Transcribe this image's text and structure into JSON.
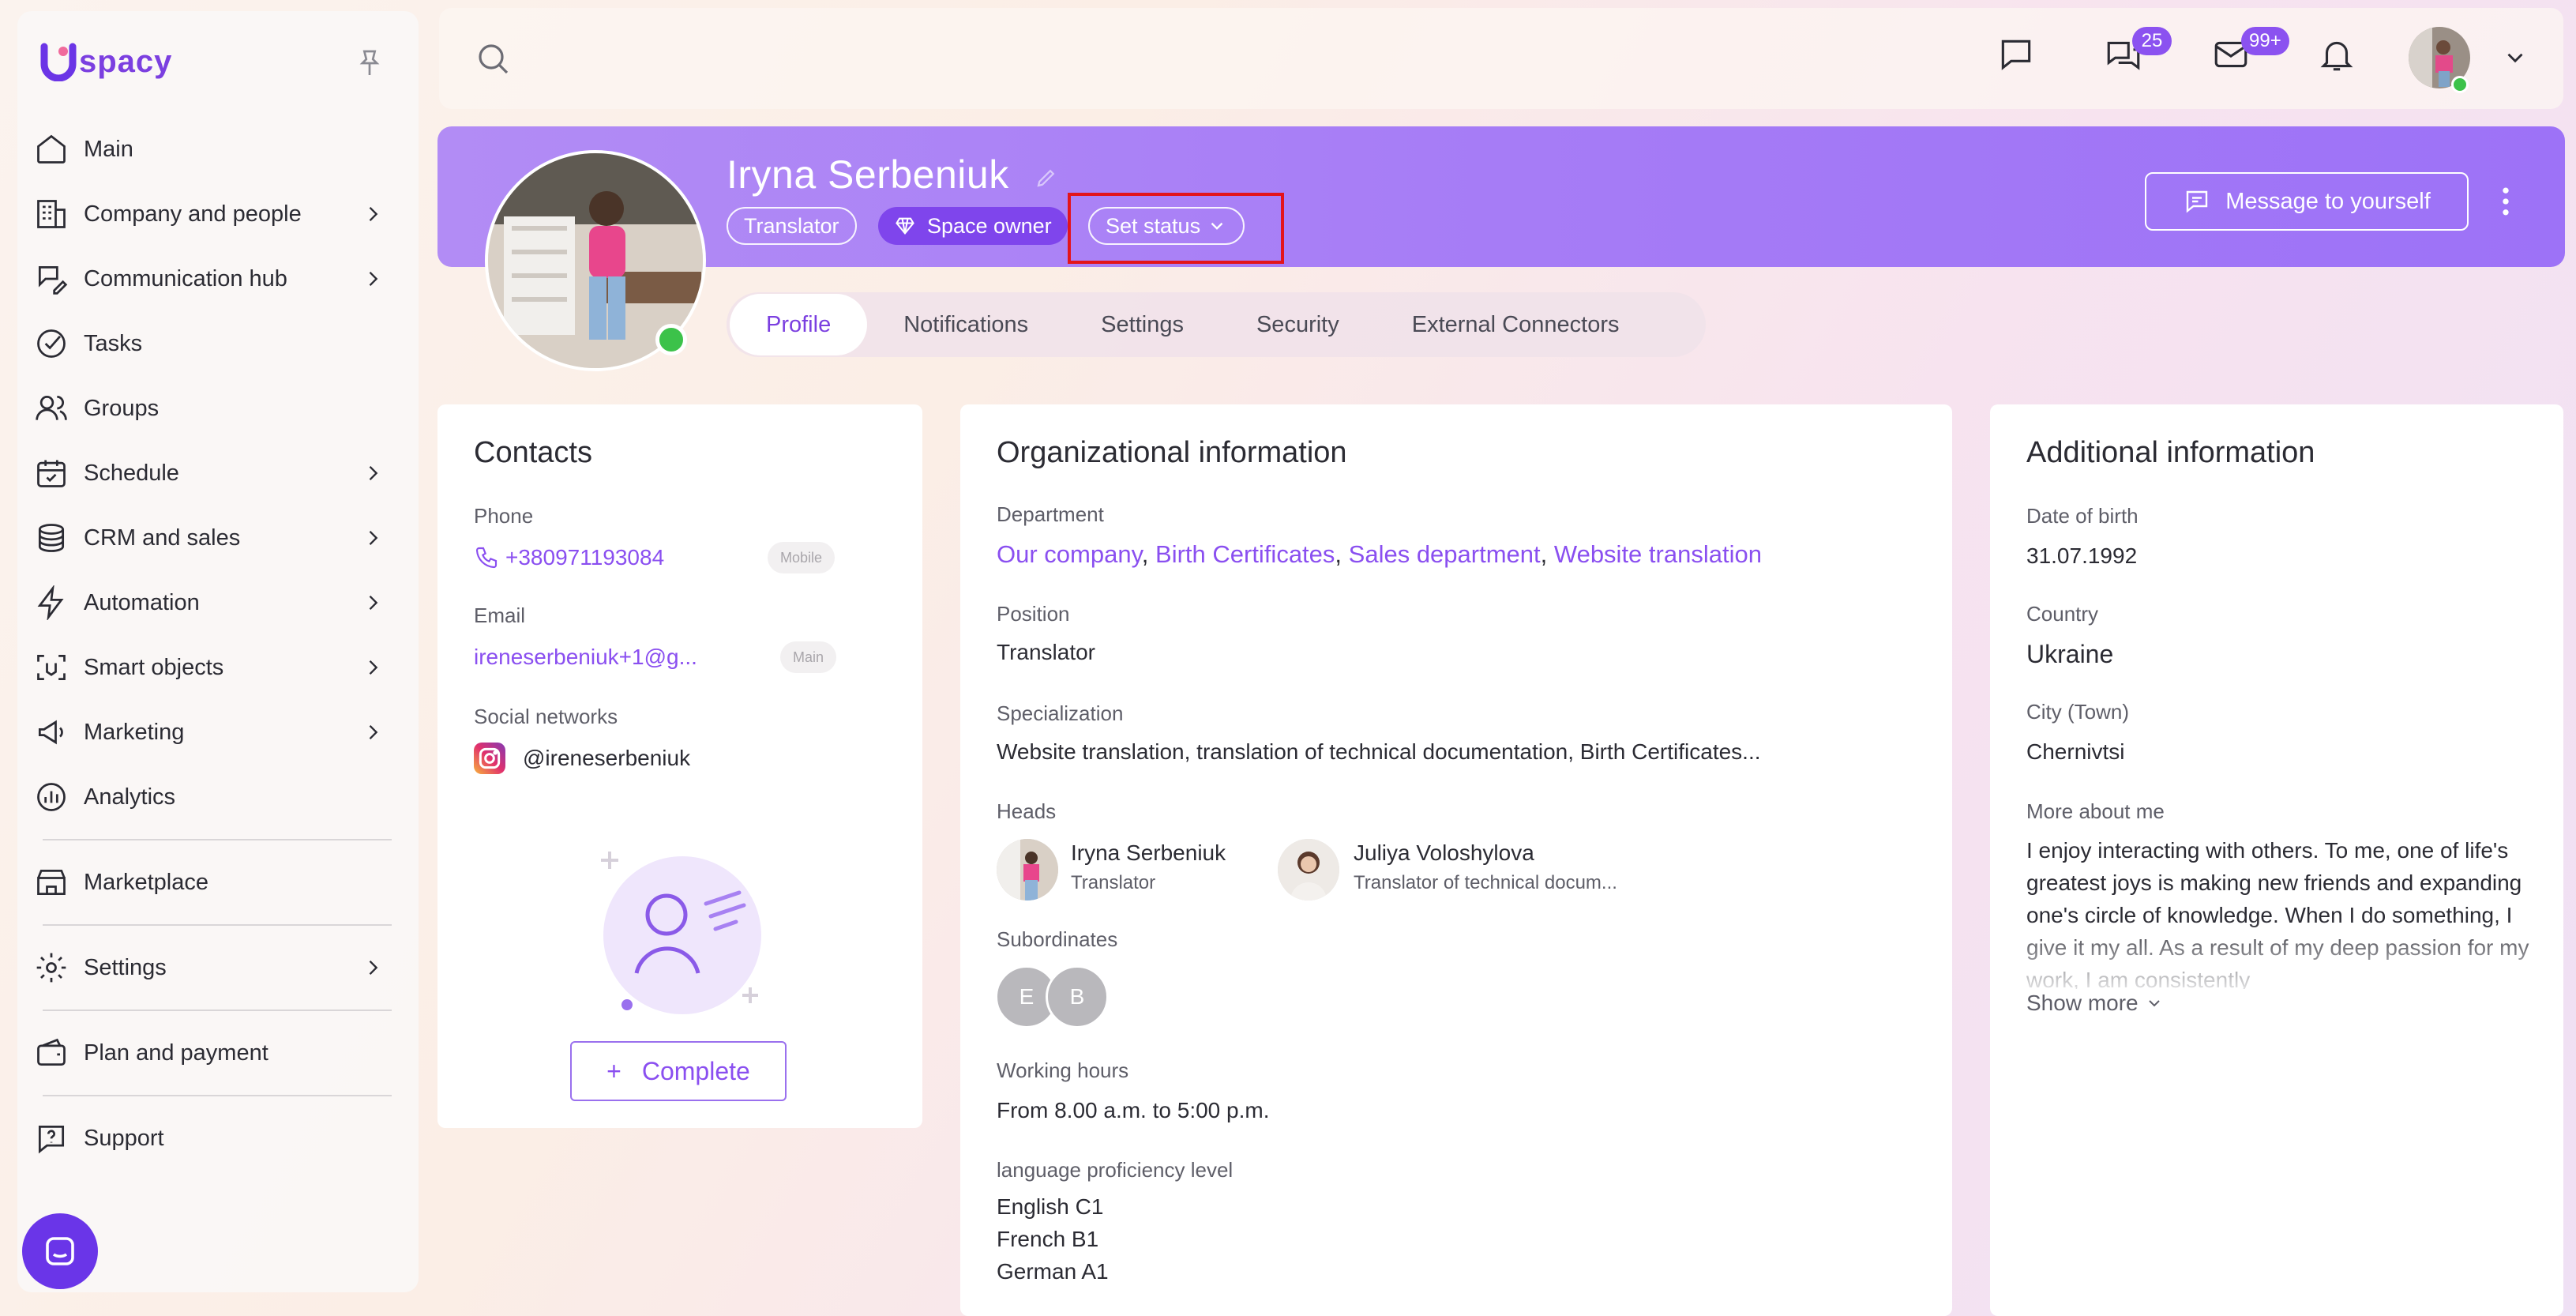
{
  "app": {
    "logo_text": "spacy"
  },
  "sidebar": {
    "items": [
      {
        "label": "Main",
        "icon": "home-icon",
        "submenu": false
      },
      {
        "label": "Company and people",
        "icon": "building-icon",
        "submenu": true
      },
      {
        "label": "Communication hub",
        "icon": "chat-edit-icon",
        "submenu": true
      },
      {
        "label": "Tasks",
        "icon": "check-circle-icon",
        "submenu": false
      },
      {
        "label": "Groups",
        "icon": "users-icon",
        "submenu": false
      },
      {
        "label": "Schedule",
        "icon": "calendar-icon",
        "submenu": true
      },
      {
        "label": "CRM and sales",
        "icon": "coins-icon",
        "submenu": true
      },
      {
        "label": "Automation",
        "icon": "lightning-icon",
        "submenu": true
      },
      {
        "label": "Smart objects",
        "icon": "scan-icon",
        "submenu": true
      },
      {
        "label": "Marketing",
        "icon": "megaphone-icon",
        "submenu": true
      },
      {
        "label": "Analytics",
        "icon": "chart-icon",
        "submenu": false
      }
    ],
    "marketplace": "Marketplace",
    "settings": "Settings",
    "plan": "Plan and payment",
    "support": "Support"
  },
  "topbar": {
    "chats_badge": "25",
    "mail_badge": "99+"
  },
  "profile": {
    "name": "Iryna Serbeniuk",
    "position_tag": "Translator",
    "role_tag": "Space owner",
    "status_button": "Set status",
    "message_button": "Message to yourself",
    "tabs": [
      "Profile",
      "Notifications",
      "Settings",
      "Security",
      "External Connectors"
    ],
    "active_tab": "Profile"
  },
  "contacts": {
    "title": "Contacts",
    "phone_label": "Phone",
    "phone": "+380971193084",
    "phone_tag": "Mobile",
    "email_label": "Email",
    "email": "ireneserbeniuk+1@g...",
    "email_tag": "Main",
    "social_label": "Social networks",
    "instagram": "@ireneserbeniuk",
    "complete_button": "Complete",
    "complete_plus": "+"
  },
  "org": {
    "title": "Organizational information",
    "department_label": "Department",
    "departments": [
      "Our company",
      "Birth Certificates",
      "Sales department",
      "Website translation"
    ],
    "position_label": "Position",
    "position": "Translator",
    "specialization_label": "Specialization",
    "specialization": "Website translation, translation of technical documentation, Birth Certificates...",
    "heads_label": "Heads",
    "heads": [
      {
        "name": "Iryna Serbeniuk",
        "role": "Translator"
      },
      {
        "name": "Juliya Voloshylova",
        "role": "Translator of technical docum..."
      }
    ],
    "subordinates_label": "Subordinates",
    "subordinates": [
      "E",
      "B"
    ],
    "hours_label": "Working hours",
    "hours": "From 8.00 a.m. to 5:00 p.m.",
    "language_label": "language proficiency level",
    "languages": [
      "English C1",
      "French B1",
      "German A1"
    ]
  },
  "additional": {
    "title": "Additional information",
    "dob_label": "Date of birth",
    "dob": "31.07.1992",
    "country_label": "Country",
    "country": "Ukraine",
    "city_label": "City (Town)",
    "city": "Chernivtsi",
    "about_label": "More about me",
    "about": "I enjoy interacting with others. To me, one of life's greatest joys is making new friends and expanding one's circle of knowledge. When I do something, I give it my all. As a result of my deep passion for my work, I am consistently",
    "show_more": "Show more"
  },
  "colors": {
    "accent": "#8a4ff0",
    "banner": "#a67cf6",
    "online": "#3cc24a",
    "highlight": "#e3141b"
  }
}
